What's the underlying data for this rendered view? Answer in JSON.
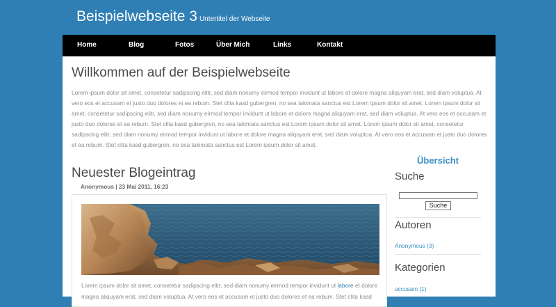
{
  "header": {
    "title": "Beispielwebseite 3",
    "subtitle": "Untertitel der Webseite"
  },
  "nav": {
    "items": [
      "Home",
      "Blog",
      "Fotos",
      "Über Mich",
      "Links",
      "Kontakt"
    ]
  },
  "main": {
    "title": "Willkommen auf der Beispielwebseite",
    "intro": "Lorem ipsum dolor sit amet, consetetur sadipscing elitr, sed diam nonumy eirmod tempor invidunt ut labore et dolore magna aliquyam erat, sed diam voluptua. At vero eos et accusam et justo duo dolores et ea rebum. Stet clita kasd gubergren, no sea takimata sanctus est Lorem ipsum dolor sit amet. Lorem ipsum dolor sit amet, consetetur sadipscing elitr, sed diam nonumy eirmod tempor invidunt ut labore et dolore magna aliquyam erat, sed diam voluptua. At vero eos et accusam et justo duo dolores et ea rebum. Stet clita kasd gubergren, no sea takimata sanctus est Lorem ipsum dolor sit amet. Lorem ipsum dolor sit amet, consetetur sadipscing elitr, sed diam nonumy eirmod tempor invidunt ut labore et dolore magna aliquyam erat, sed diam voluptua. At vero eos et accusam et justo duo dolores et ea rebum. Stet clita kasd gubergren, no sea takimata sanctus est Lorem ipsum dolor sit amet."
  },
  "blog": {
    "heading": "Neuester Blogeintrag",
    "meta": "Anonymous | 23 Mai 2011, 16:23",
    "text_before_link": "Lorem ipsum dolor sit amet, consetetur sadipscing elitr, sed diam nonumy eirmod tempor invidunt ut ",
    "link_text": "labore",
    "text_after_link": " et dolore magna aliquyam erat, sed diam voluptua. At vero eos et accusam et justo duo dolores et ea rebum. Stet clita kasd"
  },
  "sidebar": {
    "overview": "Übersicht",
    "search_heading": "Suche",
    "search_button": "Suche",
    "search_value": "",
    "authors_heading": "Autoren",
    "author_link": "Anonymous (3)",
    "categories_heading": "Kategorien",
    "category_link": "accusam (1)"
  },
  "colors": {
    "background": "#2f7fb5",
    "nav": "#000000",
    "link": "#3a8fc3"
  }
}
